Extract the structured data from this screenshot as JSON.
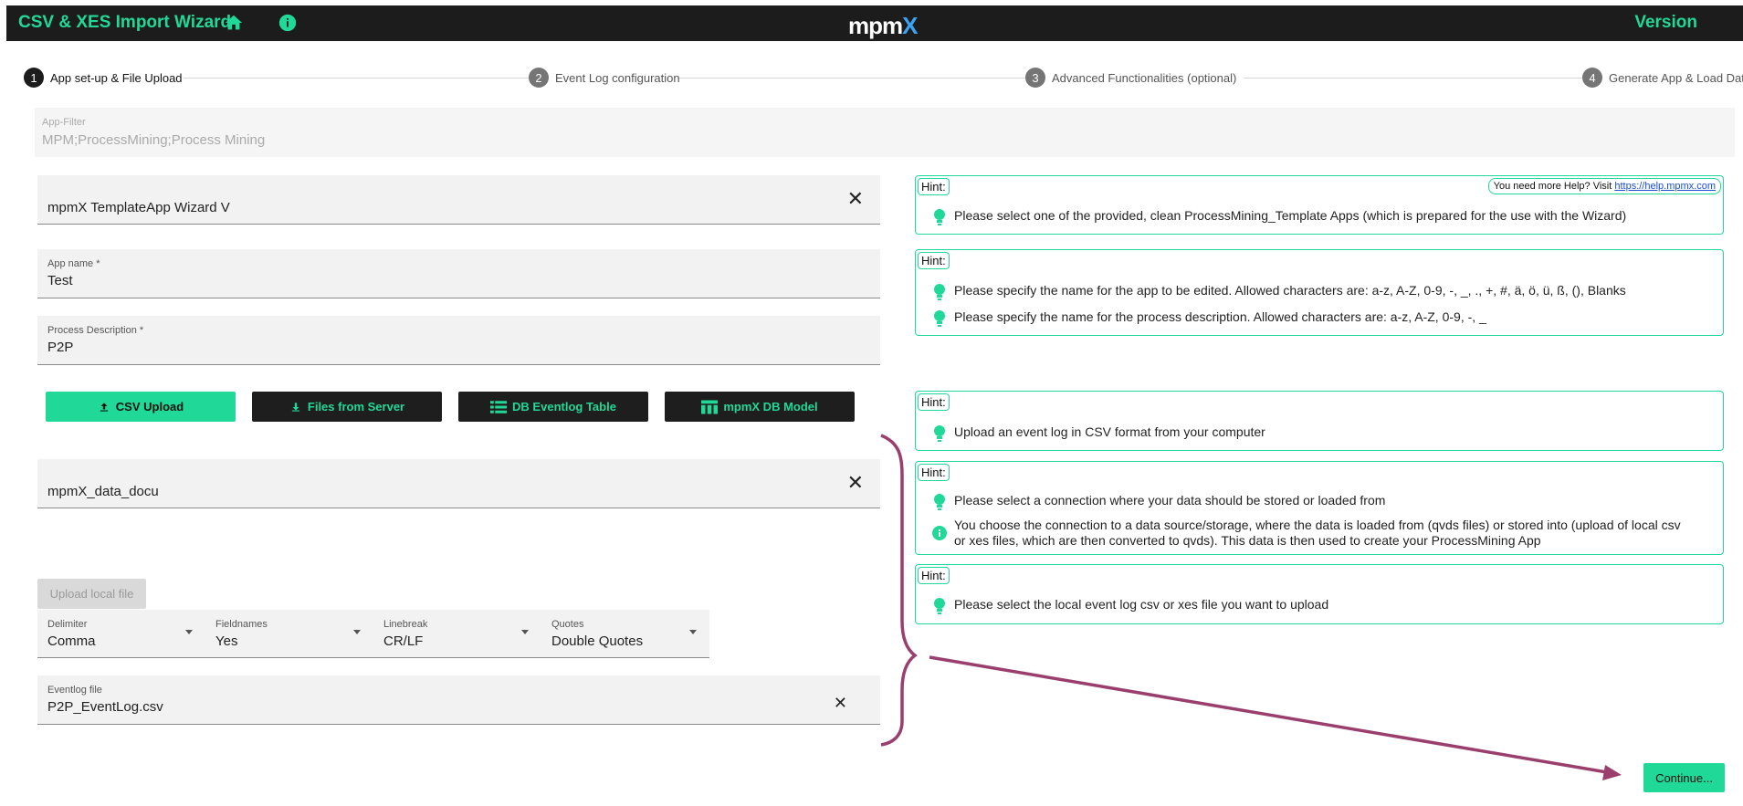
{
  "header": {
    "title": "CSV & XES Import Wizard",
    "logo_main": "mpm",
    "logo_x": "X",
    "version_label": "Version"
  },
  "stepper": {
    "steps": [
      {
        "num": "1",
        "label": "App set-up & File Upload"
      },
      {
        "num": "2",
        "label": "Event Log configuration"
      },
      {
        "num": "3",
        "label": "Advanced Functionalities (optional)"
      },
      {
        "num": "4",
        "label": "Generate App & Load Data"
      }
    ]
  },
  "app_filter": {
    "label": "App-Filter",
    "value": "MPM;ProcessMining;Process Mining"
  },
  "template_app": {
    "value": "mpmX TemplateApp Wizard V",
    "clear": "✕"
  },
  "app_name": {
    "label": "App name *",
    "value": "Test"
  },
  "process_description": {
    "label": "Process Description *",
    "value": "P2P"
  },
  "sources": {
    "csv_upload": "CSV Upload",
    "files_from_server": "Files from Server",
    "db_eventlog_table": "DB Eventlog Table",
    "mpmx_db_model": "mpmX DB Model"
  },
  "connection": {
    "value": "mpmX_data_docu",
    "clear": "✕"
  },
  "upload_local_file": "Upload local file",
  "csv_options": {
    "delimiter": {
      "label": "Delimiter",
      "value": "Comma"
    },
    "fieldnames": {
      "label": "Fieldnames",
      "value": "Yes"
    },
    "linebreak": {
      "label": "Linebreak",
      "value": "CR/LF"
    },
    "quotes": {
      "label": "Quotes",
      "value": "Double Quotes"
    }
  },
  "eventlog_file": {
    "label": "Eventlog file",
    "value": "P2P_EventLog.csv",
    "clear": "✕"
  },
  "hints": {
    "tag": "Hint:",
    "help_prefix": "You need more Help? Visit ",
    "help_link": "https://help.mpmx.com",
    "template": "Please select one of the provided, clean ProcessMining_Template Apps (which is prepared for the use with the Wizard)",
    "app_name": "Please specify the name for the app to be edited. Allowed characters are: a-z, A-Z, 0-9, -, _, ., +, #, ä, ö, ü, ß, (), Blanks",
    "process_description": "Please specify the name for the process description. Allowed characters are: a-z, A-Z, 0-9, -, _",
    "upload": "Upload an event log in CSV format from your computer",
    "connection": "Please select a connection where your data should be stored or loaded from",
    "connection_info_1": "You choose the connection to a data source/storage, where the data is loaded from (qvds files) or stored into (upload of local csv",
    "connection_info_2": "or xes files, which are then converted to qvds). This data is then used to create your ProcessMining App",
    "local_file": "Please select the local event log csv or xes file you want to upload"
  },
  "continue_label": "Continue...",
  "colors": {
    "accent": "#20d998",
    "bar": "#1c1c1c",
    "annotation": "#9a3f6d"
  }
}
